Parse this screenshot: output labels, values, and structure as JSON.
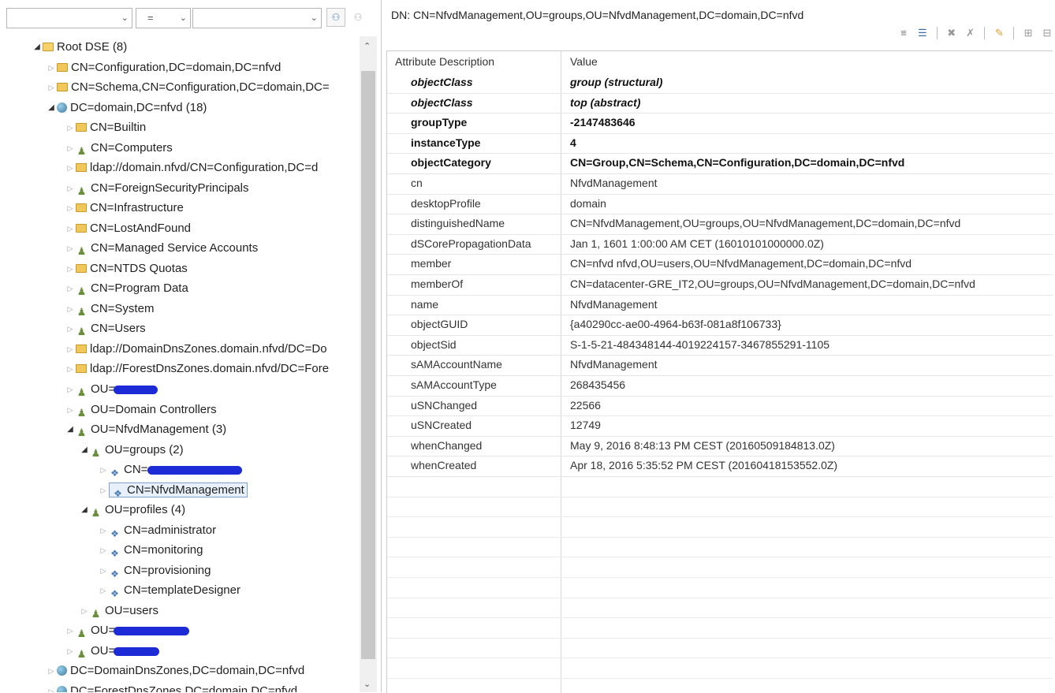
{
  "filter": {
    "combo1_text": "",
    "combo2_text": "=",
    "combo3_text": ""
  },
  "tree": {
    "root": "Root DSE (8)",
    "n1": "CN=Configuration,DC=domain,DC=nfvd",
    "n2": "CN=Schema,CN=Configuration,DC=domain,DC=",
    "n3": "DC=domain,DC=nfvd (18)",
    "n4": "CN=Builtin",
    "n5": "CN=Computers",
    "n6": "ldap://domain.nfvd/CN=Configuration,DC=d",
    "n7": "CN=ForeignSecurityPrincipals",
    "n8": "CN=Infrastructure",
    "n9": "CN=LostAndFound",
    "n10": "CN=Managed Service Accounts",
    "n11": "CN=NTDS Quotas",
    "n12": "CN=Program Data",
    "n13": "CN=System",
    "n14": "CN=Users",
    "n15": "ldap://DomainDnsZones.domain.nfvd/DC=Do",
    "n16": "ldap://ForestDnsZones.domain.nfvd/DC=Fore",
    "n17": "OU=",
    "n18": "OU=Domain Controllers",
    "n19": "OU=NfvdManagement (3)",
    "n20": "OU=groups (2)",
    "n21": "CN=",
    "n22": "CN=NfvdManagement",
    "n23": "OU=profiles (4)",
    "n24": "CN=administrator",
    "n25": "CN=monitoring",
    "n26": "CN=provisioning",
    "n27": "CN=templateDesigner",
    "n28": "OU=users",
    "n29": "OU=",
    "n30": "OU=",
    "n31": "DC=DomainDnsZones,DC=domain,DC=nfvd",
    "n32": "DC=ForestDnsZones,DC=domain,DC=nfvd"
  },
  "editor": {
    "dn": "DN: CN=NfvdManagement,OU=groups,OU=NfvdManagement,DC=domain,DC=nfvd",
    "col_attr": "Attribute Description",
    "col_value": "Value",
    "rows": [
      {
        "attr": "objectClass",
        "value": "group (structural)"
      },
      {
        "attr": "objectClass",
        "value": "top (abstract)"
      },
      {
        "attr": "groupType",
        "value": "-2147483646"
      },
      {
        "attr": "instanceType",
        "value": "4"
      },
      {
        "attr": "objectCategory",
        "value": "CN=Group,CN=Schema,CN=Configuration,DC=domain,DC=nfvd"
      },
      {
        "attr": "cn",
        "value": "NfvdManagement"
      },
      {
        "attr": "desktopProfile",
        "value": "domain"
      },
      {
        "attr": "distinguishedName",
        "value": "CN=NfvdManagement,OU=groups,OU=NfvdManagement,DC=domain,DC=nfvd"
      },
      {
        "attr": "dSCorePropagationData",
        "value": "Jan 1, 1601 1:00:00 AM CET (16010101000000.0Z)"
      },
      {
        "attr": "member",
        "value": "CN=nfvd nfvd,OU=users,OU=NfvdManagement,DC=domain,DC=nfvd"
      },
      {
        "attr": "memberOf",
        "value": "CN=datacenter-GRE_IT2,OU=groups,OU=NfvdManagement,DC=domain,DC=nfvd"
      },
      {
        "attr": "name",
        "value": "NfvdManagement"
      },
      {
        "attr": "objectGUID",
        "value": "{a40290cc-ae00-4964-b63f-081a8f106733}"
      },
      {
        "attr": "objectSid",
        "value": "S-1-5-21-484348144-4019224157-3467855291-1105"
      },
      {
        "attr": "sAMAccountName",
        "value": "NfvdManagement"
      },
      {
        "attr": "sAMAccountType",
        "value": "268435456"
      },
      {
        "attr": "uSNChanged",
        "value": "22566"
      },
      {
        "attr": "uSNCreated",
        "value": "12749"
      },
      {
        "attr": "whenChanged",
        "value": "May 9, 2016 8:48:13 PM CEST (20160509184813.0Z)"
      },
      {
        "attr": "whenCreated",
        "value": "Apr 18, 2016 5:35:52 PM CEST (20160418153552.0Z)"
      }
    ]
  }
}
